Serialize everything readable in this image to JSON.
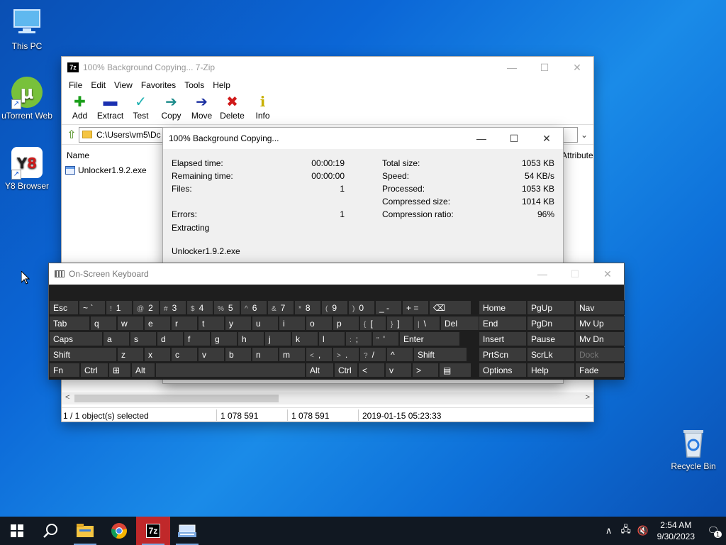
{
  "desktop": {
    "icons": [
      {
        "label": "This PC",
        "icon": "computer-icon"
      },
      {
        "label": "uTorrent Web",
        "icon": "utorrent-icon"
      },
      {
        "label": "Y8 Browser",
        "icon": "y8-icon"
      },
      {
        "label": "Recycle Bin",
        "icon": "recycle-bin-icon"
      }
    ]
  },
  "zip_window": {
    "title": "100% Background Copying... 7-Zip",
    "menu": [
      "File",
      "Edit",
      "View",
      "Favorites",
      "Tools",
      "Help"
    ],
    "toolbar": [
      {
        "label": "Add",
        "icon": "plus-icon",
        "color": "#1a9e1a",
        "glyph": "✚"
      },
      {
        "label": "Extract",
        "icon": "minus-icon",
        "color": "#1a2fb0",
        "glyph": "▬"
      },
      {
        "label": "Test",
        "icon": "check-icon",
        "color": "#1ab0b0",
        "glyph": "✓"
      },
      {
        "label": "Copy",
        "icon": "copy-arrow-icon",
        "color": "#1a8a8a",
        "glyph": "➔"
      },
      {
        "label": "Move",
        "icon": "move-arrow-icon",
        "color": "#1a2fa0",
        "glyph": "➔"
      },
      {
        "label": "Delete",
        "icon": "delete-x-icon",
        "color": "#d01a1a",
        "glyph": "✖"
      },
      {
        "label": "Info",
        "icon": "info-icon",
        "color": "#c8b000",
        "glyph": "i"
      }
    ],
    "address": "C:\\Users\\vm5\\Dc",
    "columns": {
      "name": "Name",
      "attributes": "Attribute"
    },
    "files": [
      {
        "name": "Unlocker1.9.2.exe"
      }
    ],
    "status": {
      "selected": "1 / 1 object(s) selected",
      "size": "1 078 591",
      "packed": "1 078 591",
      "modified": "2019-01-15 05:23:33"
    }
  },
  "progress_dialog": {
    "title": "100% Background Copying...",
    "left": [
      {
        "label": "Elapsed time:",
        "value": "00:00:19"
      },
      {
        "label": "Remaining time:",
        "value": "00:00:00"
      },
      {
        "label": "Files:",
        "value": "1"
      },
      {
        "label": "Errors:",
        "value": "1"
      }
    ],
    "right": [
      {
        "label": "Total size:",
        "value": "1053 KB"
      },
      {
        "label": "Speed:",
        "value": "54 KB/s"
      },
      {
        "label": "Processed:",
        "value": "1053 KB"
      },
      {
        "label": "Compressed size:",
        "value": "1014 KB"
      },
      {
        "label": "Compression ratio:",
        "value": "96%"
      }
    ],
    "operation": "Extracting",
    "current_file": "Unlocker1.9.2.exe"
  },
  "osk": {
    "title": "On-Screen Keyboard",
    "rows": [
      [
        [
          "Esc",
          ""
        ],
        [
          "~ `",
          ""
        ],
        [
          "!",
          "1"
        ],
        [
          "@",
          "2"
        ],
        [
          "#",
          "3"
        ],
        [
          "$",
          "4"
        ],
        [
          "%",
          "5"
        ],
        [
          "^",
          "6"
        ],
        [
          "&",
          "7"
        ],
        [
          "*",
          "8"
        ],
        [
          "(",
          "9"
        ],
        [
          ")",
          "0"
        ],
        [
          "_ -",
          ""
        ],
        [
          "+ =",
          ""
        ],
        [
          "⌫",
          ""
        ]
      ],
      [
        [
          "Tab",
          ""
        ],
        [
          "q",
          ""
        ],
        [
          "w",
          ""
        ],
        [
          "e",
          ""
        ],
        [
          "r",
          ""
        ],
        [
          "t",
          ""
        ],
        [
          "y",
          ""
        ],
        [
          "u",
          ""
        ],
        [
          "i",
          ""
        ],
        [
          "o",
          ""
        ],
        [
          "p",
          ""
        ],
        [
          "{",
          "["
        ],
        [
          "}",
          "]"
        ],
        [
          "|",
          "\\"
        ],
        [
          "Del",
          ""
        ]
      ],
      [
        [
          "Caps",
          ""
        ],
        [
          "a",
          ""
        ],
        [
          "s",
          ""
        ],
        [
          "d",
          ""
        ],
        [
          "f",
          ""
        ],
        [
          "g",
          ""
        ],
        [
          "h",
          ""
        ],
        [
          "j",
          ""
        ],
        [
          "k",
          ""
        ],
        [
          "l",
          ""
        ],
        [
          ":",
          ";"
        ],
        [
          "\"",
          "'"
        ],
        [
          "Enter",
          ""
        ]
      ],
      [
        [
          "Shift",
          ""
        ],
        [
          "z",
          ""
        ],
        [
          "x",
          ""
        ],
        [
          "c",
          ""
        ],
        [
          "v",
          ""
        ],
        [
          "b",
          ""
        ],
        [
          "n",
          ""
        ],
        [
          "m",
          ""
        ],
        [
          "<",
          ","
        ],
        [
          ">",
          "."
        ],
        [
          "?",
          "/"
        ],
        [
          "^",
          ""
        ],
        [
          "Shift",
          ""
        ]
      ],
      [
        [
          "Fn",
          ""
        ],
        [
          "Ctrl",
          ""
        ],
        [
          "⊞",
          ""
        ],
        [
          "Alt",
          ""
        ],
        [
          "",
          ""
        ],
        [
          "Alt",
          ""
        ],
        [
          "Ctrl",
          ""
        ],
        [
          "<",
          ""
        ],
        [
          "v",
          ""
        ],
        [
          ">",
          ""
        ],
        [
          "▤",
          ""
        ]
      ]
    ],
    "nav": [
      [
        "Home",
        "PgUp",
        "Nav"
      ],
      [
        "End",
        "PgDn",
        "Mv Up"
      ],
      [
        "Insert",
        "Pause",
        "Mv Dn"
      ],
      [
        "PrtScn",
        "ScrLk",
        "Dock"
      ],
      [
        "Options",
        "Help",
        "Fade"
      ]
    ]
  },
  "taskbar": {
    "apps": [
      {
        "name": "start",
        "icon": "windows-start-icon"
      },
      {
        "name": "search",
        "icon": "search-icon"
      },
      {
        "name": "file-explorer",
        "icon": "folder-icon"
      },
      {
        "name": "chrome",
        "icon": "chrome-icon"
      },
      {
        "name": "7zip",
        "icon": "7zip-icon",
        "label": "7z"
      },
      {
        "name": "osk",
        "icon": "keyboard-icon"
      }
    ],
    "time": "2:54 AM",
    "date": "9/30/2023",
    "notification_count": "1"
  }
}
